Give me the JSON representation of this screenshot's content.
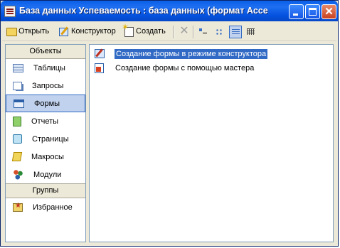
{
  "window": {
    "title": "База данных Успеваемость : база данных (формат Acces...",
    "minimize_icon": "minimize-icon",
    "maximize_icon": "maximize-icon",
    "close_glyph": "✕"
  },
  "toolbar": {
    "open_label": "Открыть",
    "design_label": "Конструктор",
    "create_label": "Создать",
    "delete_glyph": "✕",
    "views": [
      "large-icons",
      "small-icons",
      "list",
      "details"
    ],
    "active_view": "list"
  },
  "sidebar": {
    "objects_header": "Объекты",
    "items": [
      {
        "label": "Таблицы",
        "icon": "tables-icon",
        "selected": false
      },
      {
        "label": "Запросы",
        "icon": "queries-icon",
        "selected": false
      },
      {
        "label": "Формы",
        "icon": "forms-icon",
        "selected": true
      },
      {
        "label": "Отчеты",
        "icon": "reports-icon",
        "selected": false
      },
      {
        "label": "Страницы",
        "icon": "pages-icon",
        "selected": false
      },
      {
        "label": "Макросы",
        "icon": "macros-icon",
        "selected": false
      },
      {
        "label": "Модули",
        "icon": "modules-icon",
        "selected": false
      }
    ],
    "groups_header": "Группы",
    "group_items": [
      {
        "label": "Избранное",
        "icon": "favorites-icon"
      }
    ]
  },
  "content": {
    "items": [
      {
        "label": "Создание формы в режиме конструктора",
        "icon": "form-design-icon",
        "selected": true
      },
      {
        "label": "Создание формы с помощью мастера",
        "icon": "form-wizard-icon",
        "selected": false
      }
    ]
  },
  "colors": {
    "titlebar": "#0553e0",
    "selection": "#316ac5",
    "selection_light": "#c1d2ee",
    "window_bg": "#ece9d8"
  }
}
